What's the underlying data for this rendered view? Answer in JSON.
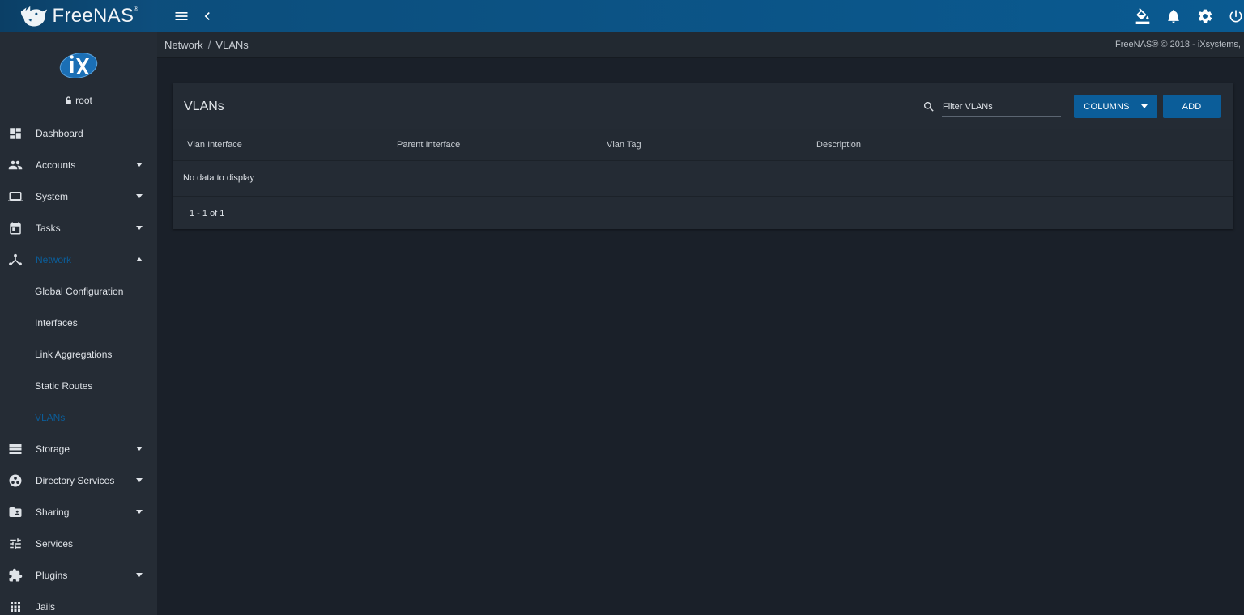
{
  "brand": {
    "name": "FreeNAS",
    "mark": "®"
  },
  "topbar": {
    "menu_icon": "hamburger-icon",
    "back_icon": "chevron-left-icon",
    "actions": [
      "paint-bucket-icon",
      "bell-icon",
      "gear-icon",
      "power-icon"
    ]
  },
  "profile": {
    "logo": "iX",
    "username": "root"
  },
  "sidebar": {
    "items": [
      {
        "label": "Dashboard",
        "icon": "dashboard-icon"
      },
      {
        "label": "Accounts",
        "icon": "people-icon"
      },
      {
        "label": "System",
        "icon": "laptop-icon"
      },
      {
        "label": "Tasks",
        "icon": "calendar-icon"
      },
      {
        "label": "Network",
        "icon": "network-icon"
      },
      {
        "label": "Storage",
        "icon": "storage-icon"
      },
      {
        "label": "Directory Services",
        "icon": "directory-icon"
      },
      {
        "label": "Sharing",
        "icon": "folder-share-icon"
      },
      {
        "label": "Services",
        "icon": "tune-icon"
      },
      {
        "label": "Plugins",
        "icon": "puzzle-icon"
      },
      {
        "label": "Jails",
        "icon": "grid-icon"
      }
    ],
    "network_sub": [
      "Global Configuration",
      "Interfaces",
      "Link Aggregations",
      "Static Routes",
      "VLANs"
    ]
  },
  "breadcrumb": {
    "parent": "Network",
    "separator": "/",
    "current": "VLANs"
  },
  "copyright": "FreeNAS® © 2018 - iXsystems,",
  "card": {
    "title": "VLANs",
    "filter_placeholder": "Filter VLANs",
    "columns_label": "COLUMNS",
    "add_label": "ADD",
    "headers": [
      "Vlan Interface",
      "Parent Interface",
      "Vlan Tag",
      "Description"
    ],
    "empty_text": "No data to display",
    "pager": "1 - 1 of 1"
  },
  "colors": {
    "accent": "#0b5d99",
    "background": "#1a2029",
    "sidebar": "#252c35"
  }
}
